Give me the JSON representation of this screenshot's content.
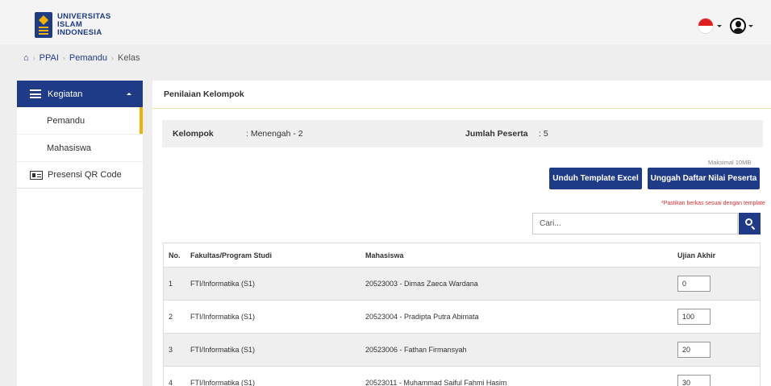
{
  "header": {
    "brand_lines": [
      "UNIVERSITAS",
      "ISLAM",
      "INDONESIA"
    ],
    "language_flag": "indonesia-flag",
    "accent_color": "#1f3a86"
  },
  "breadcrumb": {
    "items": [
      "PPAI",
      "Pemandu",
      "Kelas"
    ]
  },
  "sidebar": {
    "section_label": "Kegiatan",
    "sub_items": [
      {
        "label": "Pemandu",
        "active": true
      },
      {
        "label": "Mahasiswa",
        "active": false
      }
    ],
    "items": [
      {
        "label": "Presensi QR Code",
        "icon": "id-card-icon"
      }
    ]
  },
  "main": {
    "title": "Penilaian Kelompok",
    "info": {
      "group_label": "Kelompok",
      "group_value": ": Menengah - 2",
      "participants_label": "Jumlah Peserta",
      "participants_value": ": 5"
    },
    "max_size_note": "Maksimal 10MB",
    "download_button": "Unduh Template Excel",
    "upload_button": "Unggah Daftar Nilai Peserta",
    "warning_note": "*Pastikan berkas sesuai dengan template",
    "search_placeholder": "Cari...",
    "table": {
      "headers": [
        "No.",
        "Fakultas/Program Studi",
        "Mahasiswa",
        "Ujian Akhir"
      ],
      "rows": [
        {
          "no": "1",
          "fakultas": "FTI/Informatika (S1)",
          "mahasiswa": "20523003 - Dimas Zaeca Wardana",
          "ujian": "0"
        },
        {
          "no": "2",
          "fakultas": "FTI/Informatika (S1)",
          "mahasiswa": "20523004 - Pradipta Putra Abimata",
          "ujian": "100"
        },
        {
          "no": "3",
          "fakultas": "FTI/Informatika (S1)",
          "mahasiswa": "20523006 - Fathan Firmansyah",
          "ujian": "20"
        },
        {
          "no": "4",
          "fakultas": "FTI/Informatika (S1)",
          "mahasiswa": "20523011 - Muhammad Saiful Fahmi Hasim",
          "ujian": "30"
        }
      ]
    }
  }
}
